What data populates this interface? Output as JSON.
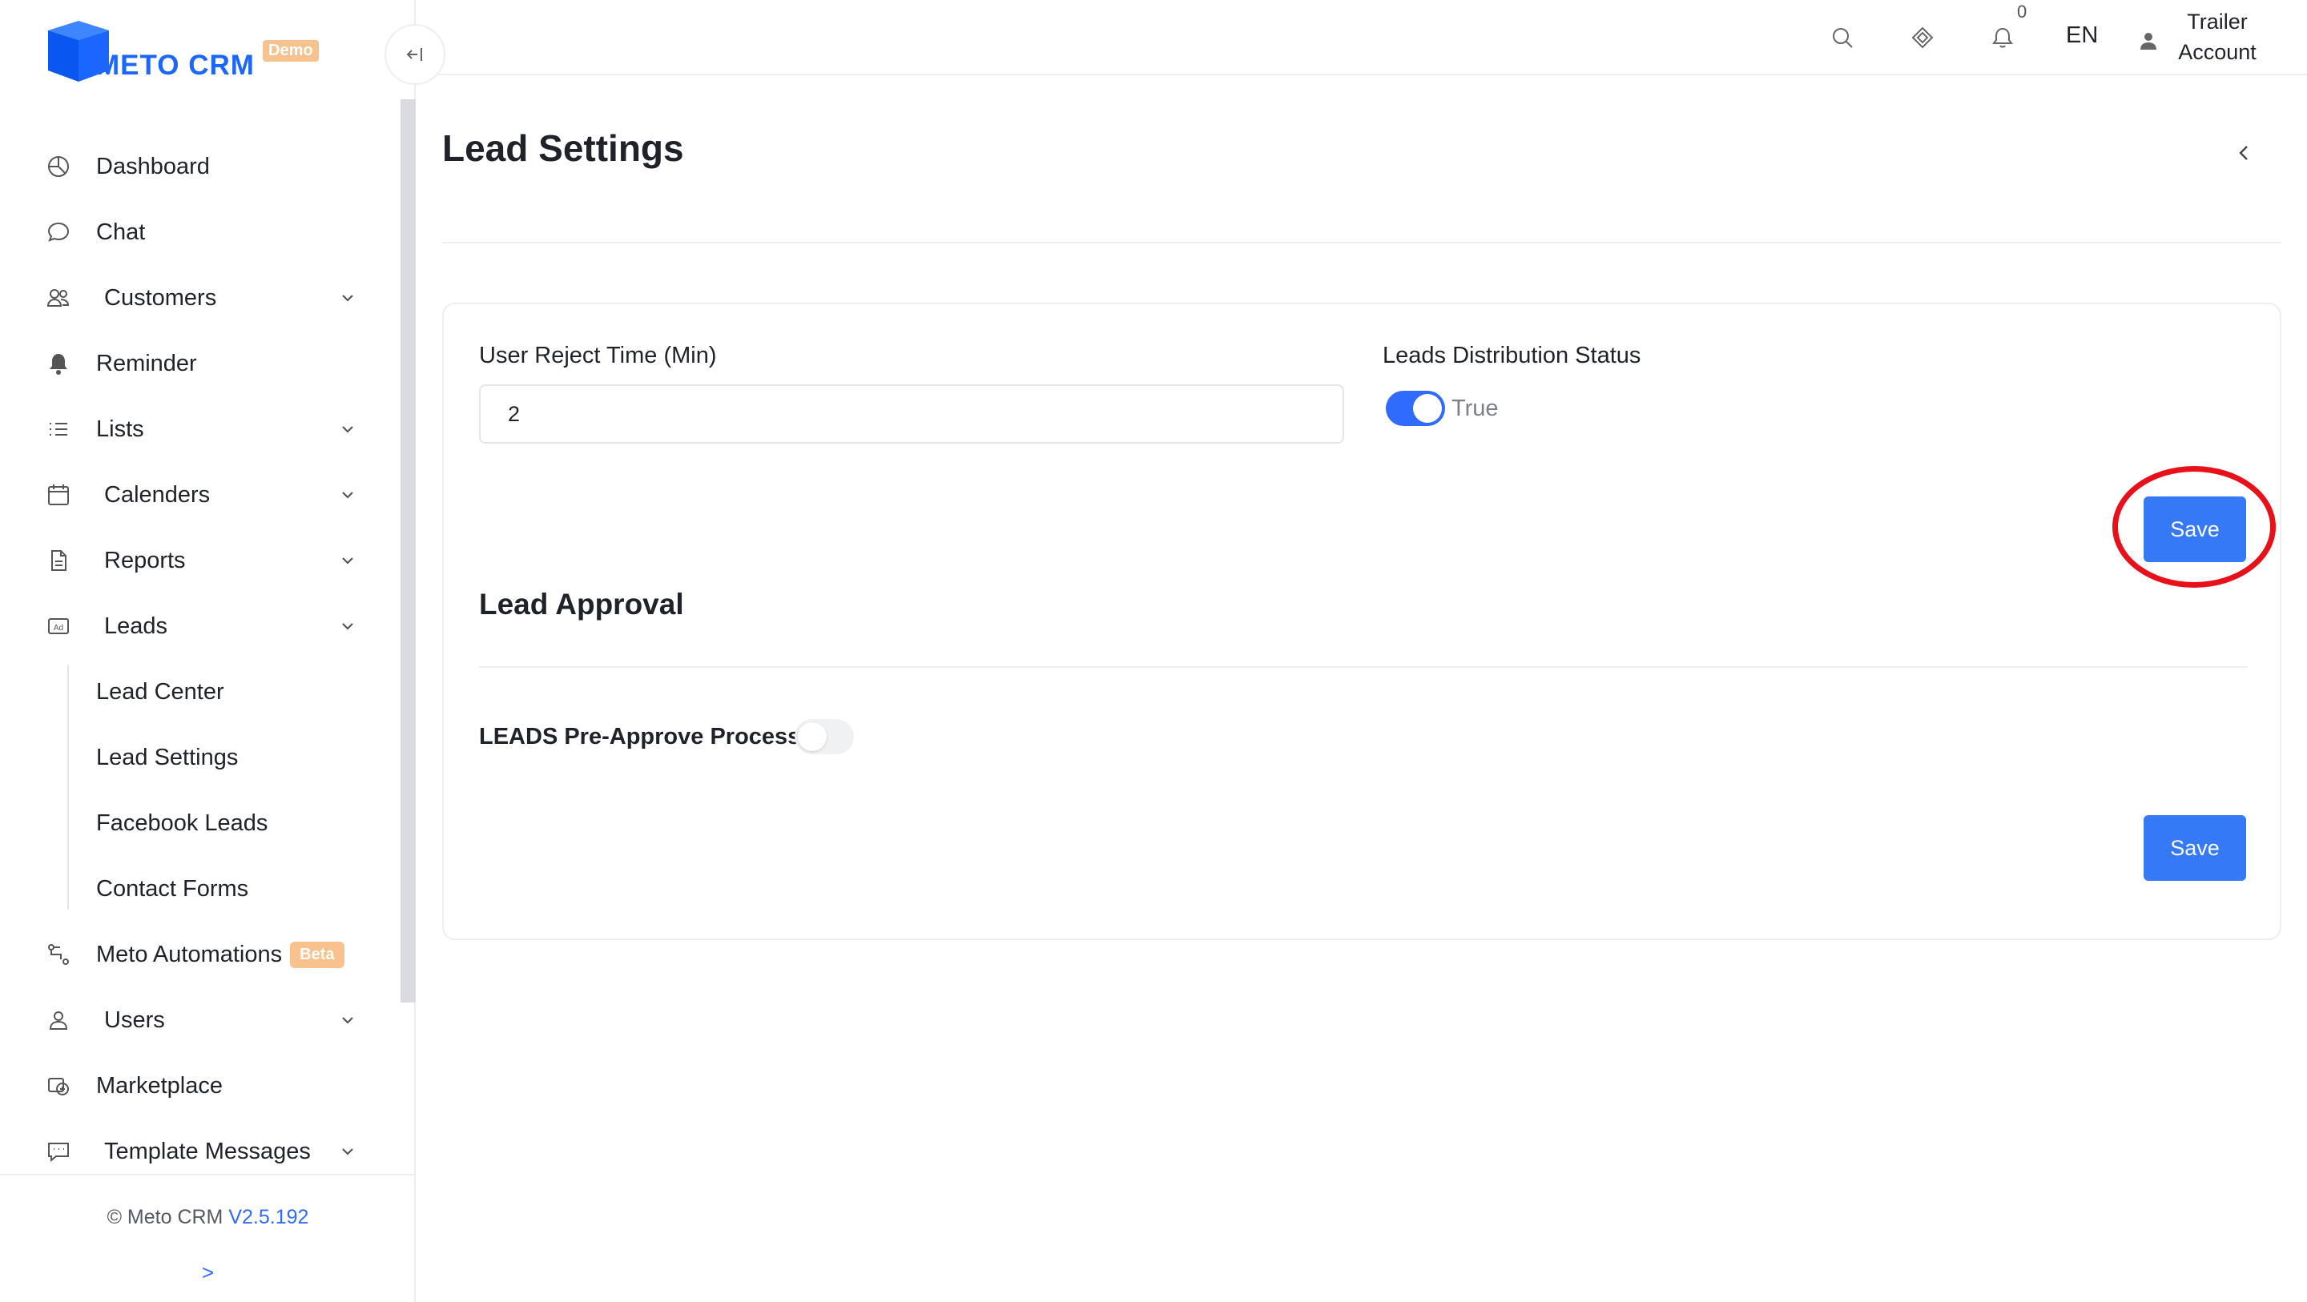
{
  "brand": {
    "name": "METO CRM",
    "env_badge": "Demo",
    "color": "#1a66ff"
  },
  "header": {
    "icons": [
      "search-icon",
      "diamond-icon",
      "bell-icon"
    ],
    "notification_count": "0",
    "language": "EN",
    "account_label": "Trailer Account"
  },
  "sidebar": {
    "items": [
      {
        "label": "Dashboard",
        "icon": "pie-chart-icon"
      },
      {
        "label": "Chat",
        "icon": "chat-bubble-icon"
      },
      {
        "label": "Customers",
        "icon": "users-group-icon",
        "expandable": true
      },
      {
        "label": "Reminder",
        "icon": "bell-filled-icon"
      },
      {
        "label": "Lists",
        "icon": "list-icon",
        "expandable": true
      },
      {
        "label": "Calenders",
        "icon": "calendar-icon",
        "expandable": true
      },
      {
        "label": "Reports",
        "icon": "report-file-icon",
        "expandable": true
      },
      {
        "label": "Leads",
        "icon": "ad-icon",
        "expandable": true,
        "expanded": true
      }
    ],
    "leads_subitems": [
      "Lead Center",
      "Lead Settings",
      "Facebook Leads",
      "Contact Forms"
    ],
    "items_after": [
      {
        "label": "Meto Automations",
        "icon": "automation-icon",
        "badge": "Beta"
      },
      {
        "label": "Users",
        "icon": "user-icon",
        "expandable": true
      },
      {
        "label": "Marketplace",
        "icon": "marketplace-icon"
      },
      {
        "label": "Template Messages",
        "icon": "template-message-icon",
        "expandable": true
      }
    ],
    "footer": {
      "copyright": "© Meto CRM",
      "version": "V2.5.192",
      "expand_symbol": ">"
    },
    "collapse_symbol": "←|"
  },
  "page": {
    "title": "Lead Settings",
    "settings": {
      "reject_time_label": "User Reject Time (Min)",
      "reject_time_value": "2",
      "distribution_label": "Leads Distribution Status",
      "distribution_enabled": true,
      "distribution_text": "True",
      "save_label": "Save"
    },
    "approval": {
      "title": "Lead Approval",
      "pre_approve_label": "LEADS Pre-Approve Process",
      "pre_approve_enabled": false,
      "save_label": "Save"
    },
    "accent_color": "#3579f6",
    "highlight_color": "#e8111a"
  }
}
